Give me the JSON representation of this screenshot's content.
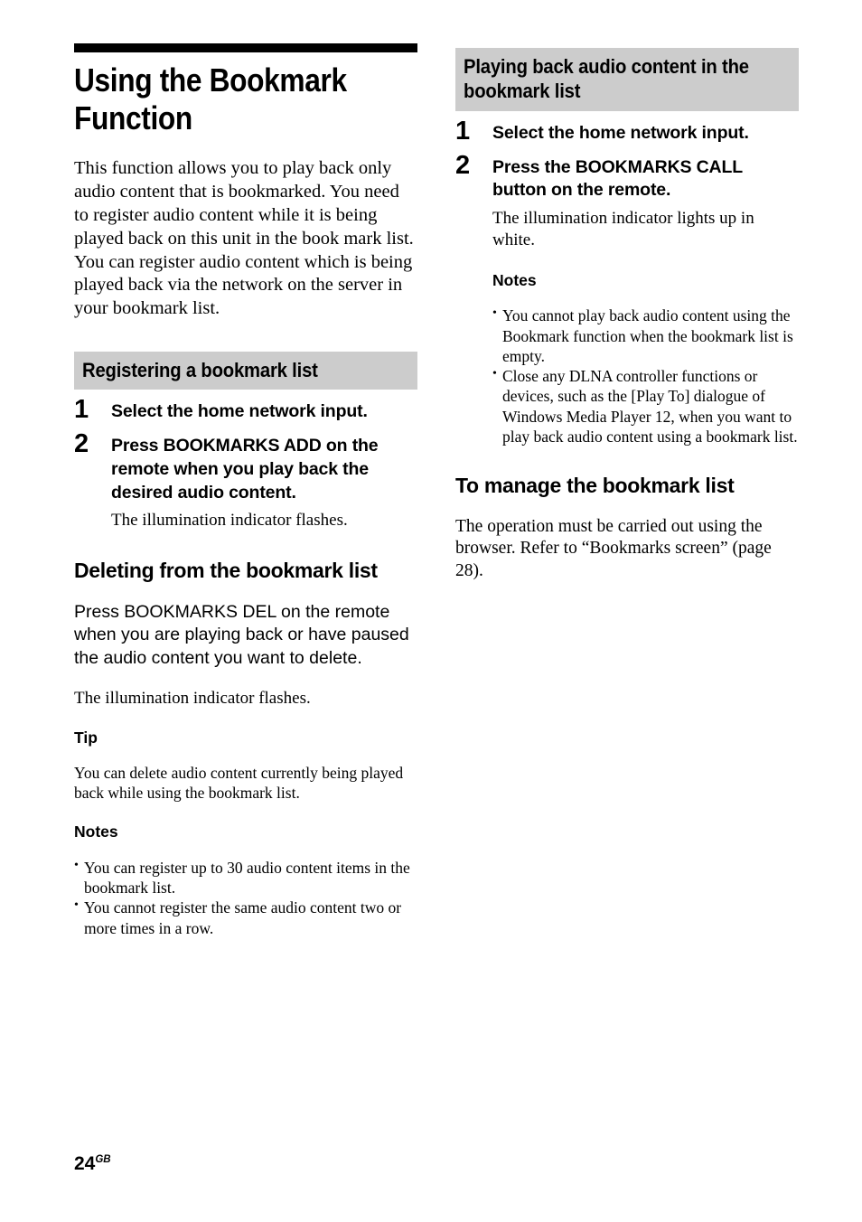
{
  "document": {
    "page_number": "24",
    "page_suffix": "GB"
  },
  "left_column": {
    "title": "Using the Bookmark Function",
    "intro_paragraphs": [
      "This function allows you to play back only audio content that is bookmarked. You need to register audio content while it is being played back on this unit in the book mark list.",
      "You can register audio content which is being played back via the network on the server in your bookmark list."
    ],
    "section": {
      "heading": "Registering a bookmark list",
      "steps": [
        {
          "number": "1",
          "text": "Select the home network input.",
          "note": ""
        },
        {
          "number": "2",
          "text": "Press BOOKMARKS ADD on the remote when you play back the desired audio content.",
          "note": "The illumination indicator flashes."
        }
      ]
    },
    "deleting": {
      "heading": "Deleting from the bookmark list",
      "body": "Press BOOKMARKS DEL on the remote when you are playing back or have paused the audio content you want to delete.",
      "body_note": "The illumination indicator flashes."
    },
    "tip": {
      "heading": "Tip",
      "body": "You can delete audio content currently being played back while using the bookmark list."
    },
    "notes": {
      "heading": "Notes",
      "items": [
        "You can register up to 30 audio content items in the bookmark list.",
        "You cannot register the same audio content two or more times in a row."
      ]
    }
  },
  "right_column": {
    "section": {
      "heading": "Playing back audio content in the bookmark list",
      "steps": [
        {
          "number": "1",
          "text": "Select the home network input.",
          "note": ""
        },
        {
          "number": "2",
          "text": "Press the BOOKMARKS CALL button on the remote.",
          "note": "The illumination indicator lights up in white."
        }
      ]
    },
    "notes": {
      "heading": "Notes",
      "items": [
        "You cannot play back audio content using the Bookmark function when the bookmark list is empty.",
        "Close any DLNA controller functions or devices, such as the [Play To] dialogue of Windows Media Player 12, when you want to play back audio content using a bookmark list."
      ]
    },
    "manage": {
      "heading": "To manage the bookmark list",
      "body": "The operation must be carried out using the browser. Refer to “Bookmarks screen” (page 28)."
    }
  },
  "colors": {
    "section_header_bg": "#cccccc",
    "title_rule": "#000000",
    "text": "#000000"
  }
}
